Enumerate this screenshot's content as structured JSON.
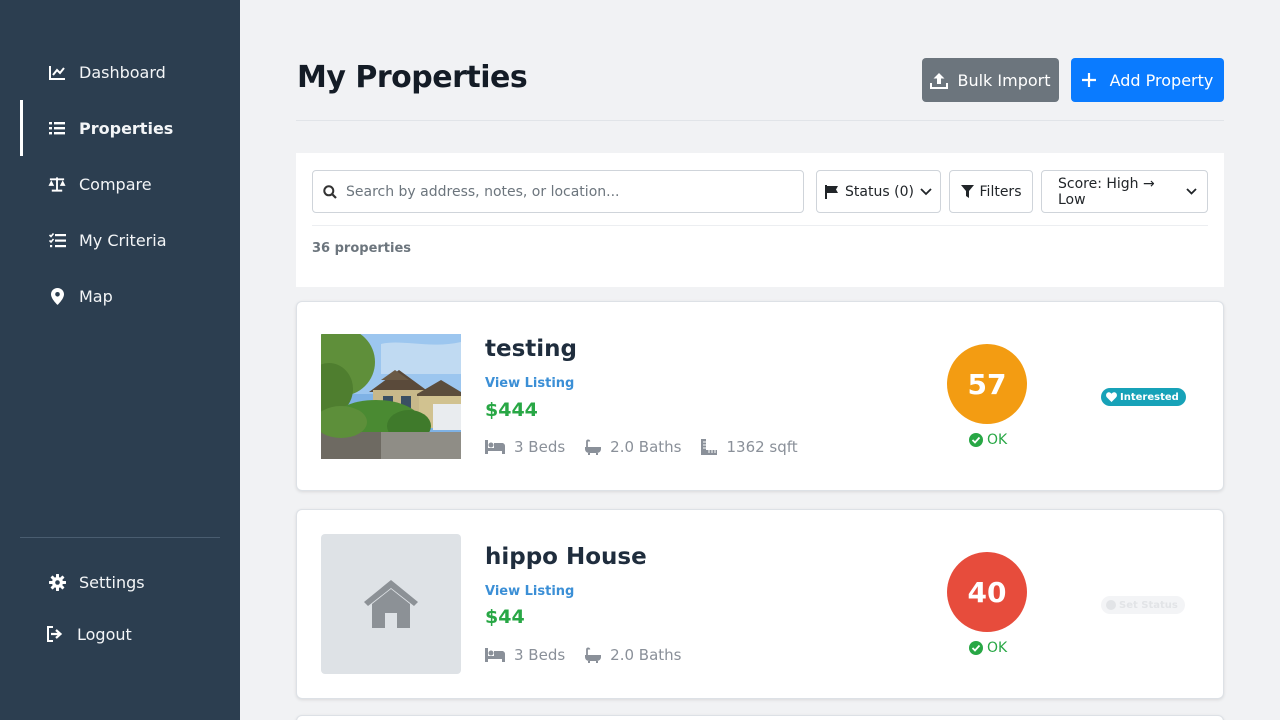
{
  "sidebar": {
    "items": [
      {
        "label": "Dashboard",
        "icon": "chart-line-icon",
        "active": false
      },
      {
        "label": "Properties",
        "icon": "list-icon",
        "active": true
      },
      {
        "label": "Compare",
        "icon": "scale-icon",
        "active": false
      },
      {
        "label": "My Criteria",
        "icon": "checklist-icon",
        "active": false
      },
      {
        "label": "Map",
        "icon": "map-pin-icon",
        "active": false
      }
    ],
    "bottom": [
      {
        "label": "Settings",
        "icon": "gear-icon"
      },
      {
        "label": "Logout",
        "icon": "logout-icon"
      }
    ]
  },
  "header": {
    "title": "My Properties",
    "bulk_import_label": "Bulk Import",
    "add_property_label": "Add Property"
  },
  "toolbar": {
    "search_placeholder": "Search by address, notes, or location...",
    "status_label": "Status (0)",
    "filters_label": "Filters",
    "sort_selected": "Score: High → Low",
    "count_text": "36 properties"
  },
  "properties": [
    {
      "title": "testing",
      "link": "View Listing",
      "price": "$444",
      "beds": "3 Beds",
      "baths": "2.0 Baths",
      "sqft": "1362 sqft",
      "score": "57",
      "score_status": "OK",
      "badge": "Interested"
    },
    {
      "title": "hippo House",
      "link": "View Listing",
      "price": "$44",
      "beds": "3 Beds",
      "baths": "2.0 Baths",
      "score": "40",
      "score_status": "OK",
      "badge": "Set Status"
    }
  ],
  "colors": {
    "sidebar_bg": "#2c3e50",
    "primary": "#0a7bff",
    "secondary": "#6c757d",
    "price_green": "#28a745",
    "score_orange": "#f39c12",
    "score_red": "#e74c3c",
    "badge_teal": "#17a2b8"
  }
}
